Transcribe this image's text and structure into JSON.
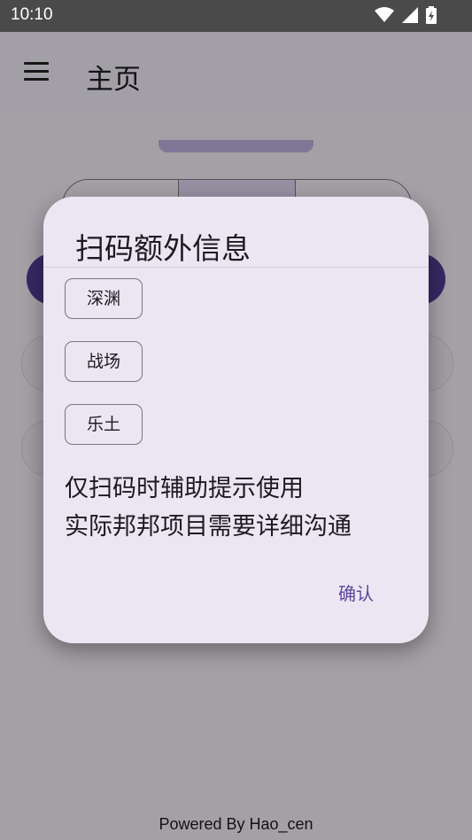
{
  "status_bar": {
    "time": "10:10"
  },
  "app_bar": {
    "title": "主页"
  },
  "footer": {
    "text": "Powered By Hao_cen"
  },
  "dialog": {
    "title": "扫码额外信息",
    "options": [
      "深渊",
      "战场",
      "乐土"
    ],
    "message_lines": [
      "仅扫码时辅助提示使用",
      "实际邦邦项目需要详细沟通"
    ],
    "confirm_label": "确认"
  },
  "colors": {
    "accent": "#5b45a0",
    "primary_button": "#4f3a8f",
    "dialog_bg": "#ece6f3"
  },
  "icons": {
    "menu": "menu-icon",
    "wifi": "wifi-icon",
    "signal": "signal-icon",
    "battery": "battery-icon"
  }
}
